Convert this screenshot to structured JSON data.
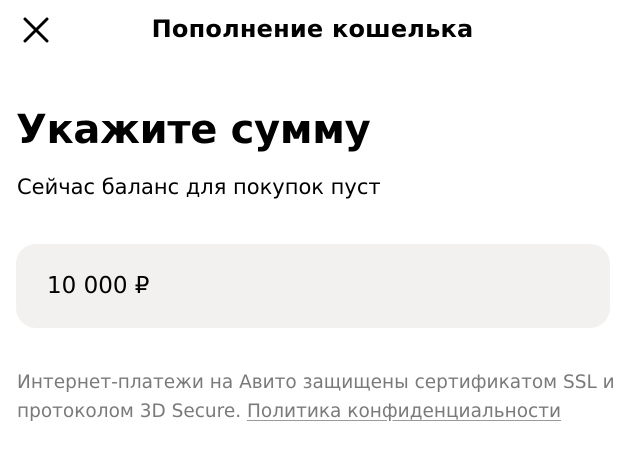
{
  "header": {
    "close_icon": "close-icon",
    "title": "Пополнение кошелька"
  },
  "main": {
    "title": "Укажите сумму",
    "subtitle": "Сейчас баланс для покупок пуст",
    "amount_field": {
      "value": "10 000 ₽"
    },
    "disclaimer": {
      "text": "Интернет-платежи на Авито защищены сертификатом SSL и протоколом 3D Secure. ",
      "link_label": "Политика конфиденциальности"
    }
  },
  "colors": {
    "background": "#ffffff",
    "field_background": "#f2f1f0",
    "muted_text": "#7a7a7a",
    "text": "#000000"
  }
}
